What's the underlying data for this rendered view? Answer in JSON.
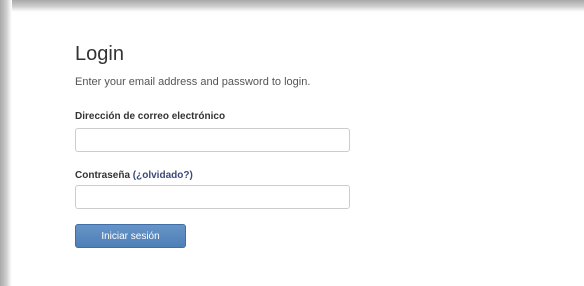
{
  "login": {
    "title": "Login",
    "subtitle": "Enter your email address and password to login.",
    "email_label": "Dirección de correo electrónico",
    "email_value": "",
    "password_label": "Contraseña",
    "forgot_link": "(¿olvidado?)",
    "password_value": "",
    "submit_label": "Iniciar sesión"
  },
  "colors": {
    "button": "#5585bd",
    "link": "#3a4a7a",
    "input_border": "#cccccc"
  }
}
